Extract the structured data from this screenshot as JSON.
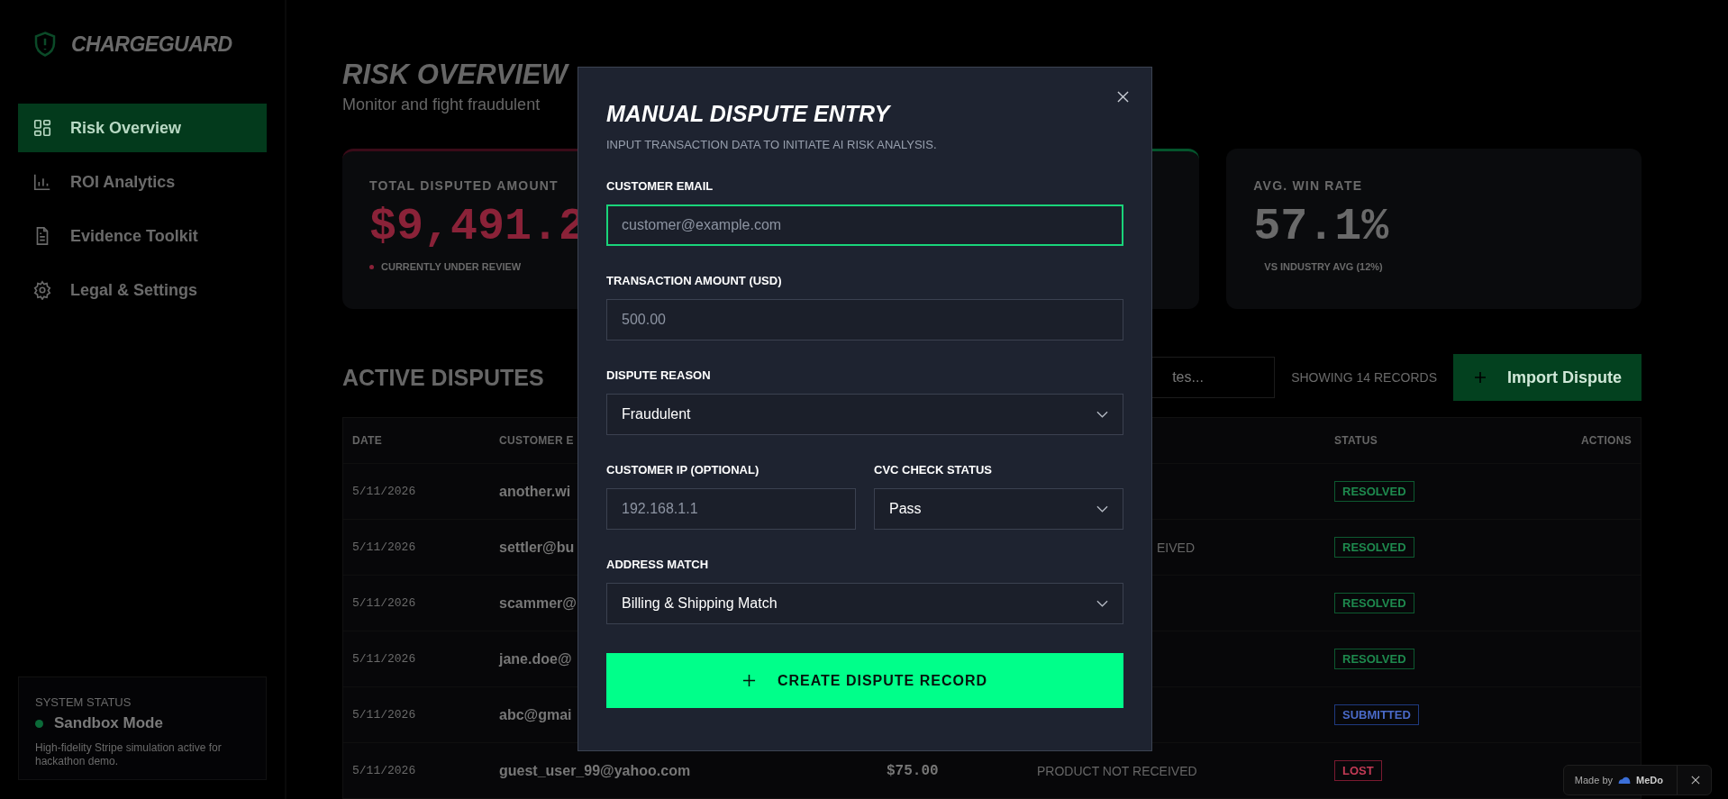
{
  "sidebar": {
    "logo": "CHARGEGUARD",
    "items": [
      {
        "label": "Risk Overview",
        "selected": true
      },
      {
        "label": "ROI Analytics",
        "selected": false
      },
      {
        "label": "Evidence Toolkit",
        "selected": false
      },
      {
        "label": "Legal & Settings",
        "selected": false
      }
    ],
    "status": {
      "heading": "SYSTEM STATUS",
      "mode": "Sandbox Mode",
      "description": "High-fidelity Stripe simulation active for hackathon demo."
    }
  },
  "page": {
    "title": "RISK OVERVIEW",
    "subtitle": "Monitor and fight fraudulent"
  },
  "cards": [
    {
      "kind": "alert",
      "label": "TOTAL DISPUTED AMOUNT",
      "value": "$9,491.2",
      "note": "CURRENTLY UNDER REVIEW"
    },
    {
      "kind": "success"
    },
    {
      "kind": "plain",
      "label": "AVG. WIN RATE",
      "value": "57.1%",
      "note": "VS INDUSTRY AVG (12%)"
    }
  ],
  "disputes": {
    "title": "ACTIVE DISPUTES",
    "search": {
      "placeholder": "tes..."
    },
    "count": "SHOWING 14 RECORDS",
    "import_button": "Import Dispute",
    "columns": [
      "DATE",
      "CUSTOMER E",
      "STATUS",
      "ACTIONS"
    ],
    "rows": [
      {
        "date": "5/11/2026",
        "customer": "another.wi",
        "status": {
          "label": "RESOLVED",
          "kind": "resolved"
        }
      },
      {
        "date": "5/11/2026",
        "customer": "settler@bu",
        "reason": "EIVED",
        "status": {
          "label": "RESOLVED",
          "kind": "resolved"
        }
      },
      {
        "date": "5/11/2026",
        "customer": "scammer@",
        "status": {
          "label": "RESOLVED",
          "kind": "resolved"
        }
      },
      {
        "date": "5/11/2026",
        "customer": "jane.doe@",
        "status": {
          "label": "RESOLVED",
          "kind": "resolved"
        }
      },
      {
        "date": "5/11/2026",
        "customer": "abc@gmai",
        "status": {
          "label": "SUBMITTED",
          "kind": "submitted"
        }
      },
      {
        "date": "5/11/2026",
        "customer": "guest_user_99@yahoo.com",
        "amount": "$75.00",
        "reason": "PRODUCT NOT RECEIVED",
        "status": {
          "label": "LOST",
          "kind": "lost"
        }
      }
    ]
  },
  "modal": {
    "title": "MANUAL DISPUTE ENTRY",
    "subtitle": "INPUT TRANSACTION DATA TO INITIATE AI RISK ANALYSIS.",
    "field_rows": [
      [
        {
          "label": "CUSTOMER EMAIL",
          "kind": "input",
          "placeholder": "customer@example.com",
          "focused": true
        }
      ],
      [
        {
          "label": "TRANSACTION AMOUNT (USD)",
          "kind": "input",
          "placeholder": "500.00",
          "focused": false
        }
      ],
      [
        {
          "label": "DISPUTE REASON",
          "kind": "select",
          "value": "Fraudulent",
          "focused": false
        }
      ],
      [
        {
          "label": "CUSTOMER IP (OPTIONAL)",
          "kind": "input",
          "placeholder": "192.168.1.1",
          "focused": false
        },
        {
          "label": "CVC CHECK STATUS",
          "kind": "select",
          "value": "Pass",
          "focused": false
        }
      ],
      [
        {
          "label": "ADDRESS MATCH",
          "kind": "select",
          "value": "Billing & Shipping Match",
          "focused": false
        }
      ]
    ],
    "submit_button": "CREATE DISPUTE RECORD"
  },
  "badge": {
    "text": "Made by",
    "brand": "MeDo"
  }
}
